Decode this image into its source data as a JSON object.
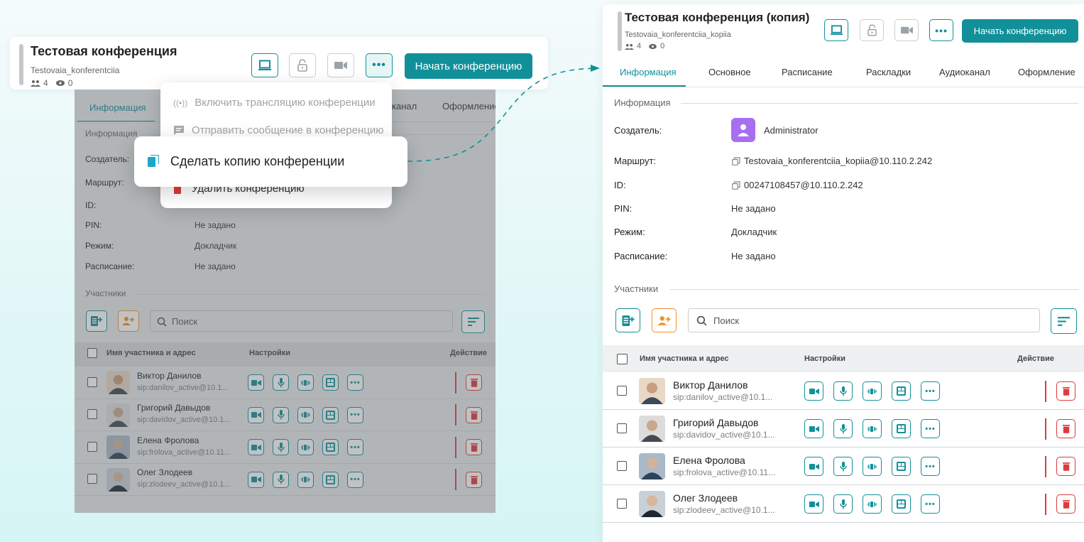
{
  "left": {
    "title": "Тестовая конференция",
    "subtitle": "Testovaia_konferentciia",
    "participants_count": "4",
    "viewers_count": "0",
    "start_button": "Начать конференцию",
    "tabs": [
      "Информация",
      "канал",
      "Оформление"
    ],
    "info_section": "Информация",
    "rows": [
      {
        "label": "Создатель:",
        "value": ""
      },
      {
        "label": "Маршрут:",
        "value": ""
      },
      {
        "label": "ID:",
        "value": ""
      },
      {
        "label": "PIN:",
        "value": "Не задано"
      },
      {
        "label": "Режим:",
        "value": "Докладчик"
      },
      {
        "label": "Расписание:",
        "value": "Не задано"
      }
    ],
    "participants_section": "Участники",
    "search_placeholder": "Поиск",
    "table_headers": {
      "name": "Имя участника и адрес",
      "settings": "Настройки",
      "action": "Действие"
    },
    "participants": [
      {
        "name": "Виктор Данилов",
        "address": "sip:danilov_active@10.1..."
      },
      {
        "name": "Григорий Давыдов",
        "address": "sip:davidov_active@10.1..."
      },
      {
        "name": "Елена Фролова",
        "address": "sip:frolova_active@10.11..."
      },
      {
        "name": "Олег Злодеев",
        "address": "sip:zlodeev_active@10.1..."
      }
    ]
  },
  "menu": {
    "items": [
      {
        "icon": "broadcast-icon",
        "label": "Включить трансляцию конференции"
      },
      {
        "icon": "message-icon",
        "label": "Отправить сообщение в конференцию"
      },
      {
        "icon": "copy-icon",
        "label": "Сделать копию конференции"
      },
      {
        "icon": "trash-icon",
        "label": "Удалить конференцию"
      }
    ]
  },
  "right": {
    "title": "Тестовая конференция (копия)",
    "subtitle": "Testovaia_konferentciia_kopiia",
    "participants_count": "4",
    "viewers_count": "0",
    "start_button": "Начать конференцию",
    "tabs": [
      "Информация",
      "Основное",
      "Расписание",
      "Раскладки",
      "Аудиоканал",
      "Оформление"
    ],
    "info_section": "Информация",
    "rows": [
      {
        "label": "Создатель:",
        "value": "Administrator"
      },
      {
        "label": "Маршрут:",
        "value": "Testovaia_konferentciia_kopiia@10.110.2.242"
      },
      {
        "label": "ID:",
        "value": "00247108457@10.110.2.242"
      },
      {
        "label": "PIN:",
        "value": "Не задано"
      },
      {
        "label": "Режим:",
        "value": "Докладчик"
      },
      {
        "label": "Расписание:",
        "value": "Не задано"
      }
    ],
    "participants_section": "Участники",
    "search_placeholder": "Поиск",
    "table_headers": {
      "name": "Имя участника и адрес",
      "settings": "Настройки",
      "action": "Действие"
    },
    "participants": [
      {
        "name": "Виктор Данилов",
        "address": "sip:danilov_active@10.1..."
      },
      {
        "name": "Григорий Давыдов",
        "address": "sip:davidov_active@10.1..."
      },
      {
        "name": "Елена Фролова",
        "address": "sip:frolova_active@10.11..."
      },
      {
        "name": "Олег Злодеев",
        "address": "sip:zlodeev_active@10.1..."
      }
    ]
  },
  "colors": {
    "accent": "#11909a",
    "danger": "#e0393c",
    "highlight_icon": "#1aa7c9",
    "avatar_admin": "#a86ef0"
  }
}
